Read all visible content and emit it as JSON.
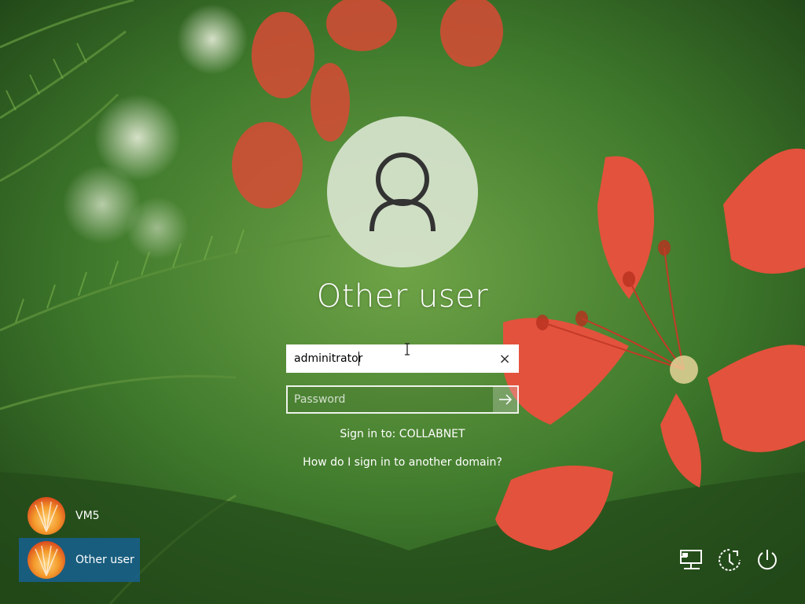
{
  "login": {
    "title": "Other user",
    "username_value": "adminitrator",
    "password_placeholder": "Password",
    "sign_in_to": "Sign in to: COLLABNET",
    "help_link": "How do I sign in to another domain?",
    "clear_icon_glyph": "×"
  },
  "user_list": [
    {
      "name": "VM5",
      "selected": false
    },
    {
      "name": "Other user",
      "selected": true
    }
  ],
  "system_icons": [
    "network-icon",
    "ease-of-access-icon",
    "power-icon"
  ],
  "colors": {
    "selected_tile": "#17608c",
    "text": "#ffffff",
    "avatar_circle": "#dee8d6",
    "background": "#2f5a23"
  }
}
